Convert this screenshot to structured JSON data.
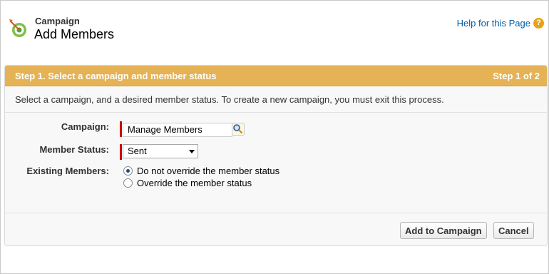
{
  "header": {
    "kicker": "Campaign",
    "title": "Add Members",
    "help_link": "Help for this Page",
    "help_icon": "?"
  },
  "step": {
    "title": "Step 1. Select a campaign and member status",
    "progress": "Step 1 of 2"
  },
  "description": "Select a campaign, and a desired member status. To create a new campaign, you must exit this process.",
  "form": {
    "campaign_label": "Campaign:",
    "campaign_value": "Manage Members",
    "status_label": "Member Status:",
    "status_value": "Sent",
    "existing_label": "Existing Members:",
    "options": [
      "Do not override the member status",
      "Override the member status"
    ],
    "selected_option": 0
  },
  "buttons": {
    "add": "Add to Campaign",
    "cancel": "Cancel"
  },
  "colors": {
    "step_bar": "#e5b256",
    "link": "#015ba7",
    "required": "#cc0000"
  }
}
